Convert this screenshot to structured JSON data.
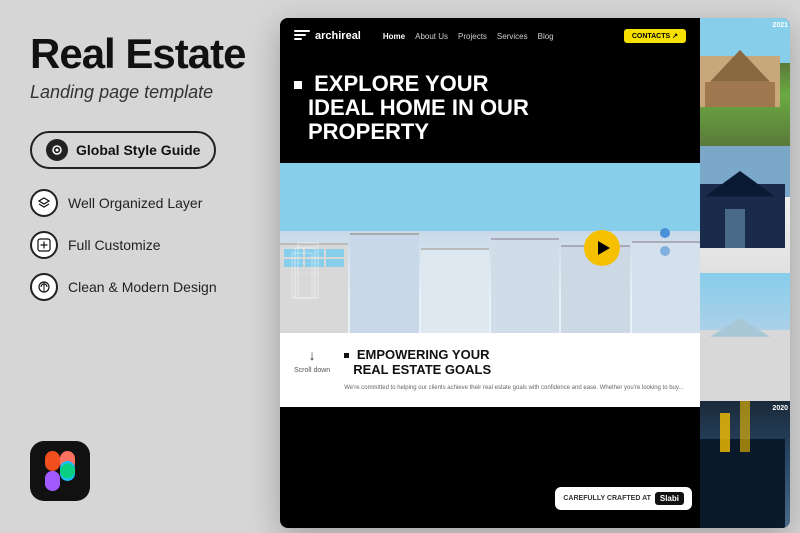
{
  "left": {
    "main_title": "Real Estate",
    "subtitle": "Landing page template",
    "style_guide_label": "Global Style Guide",
    "features": [
      {
        "id": "organized",
        "label": "Well Organized Layer",
        "icon": "layers"
      },
      {
        "id": "customize",
        "label": "Full Customize",
        "icon": "sliders"
      },
      {
        "id": "design",
        "label": "Clean & Modern Design",
        "icon": "design"
      }
    ]
  },
  "mockup": {
    "nav": {
      "logo": "archireal",
      "links": [
        "Home",
        "About Us",
        "Projects",
        "Services",
        "Blog"
      ],
      "cta": "CONTACTS ↗"
    },
    "hero": {
      "title_line1": "EXPLORE YOUR",
      "title_line2": "IDEAL HOME IN OUR",
      "title_line3": "PROPERTY"
    },
    "section2": {
      "scroll_label": "Scroll down",
      "title_line1": "EMPOWERING YOUR",
      "title_line2": "REAL ESTATE GOALS",
      "body": "We're committed to helping our clients achieve their real estate goals with confidence and ease. Whether you're looking to buy..."
    },
    "crafted_badge": {
      "text": "CAREFULLY CRAFTED AT",
      "brand": "Slabi"
    }
  },
  "years": [
    "2021",
    "2020"
  ],
  "figma_icon": "F"
}
